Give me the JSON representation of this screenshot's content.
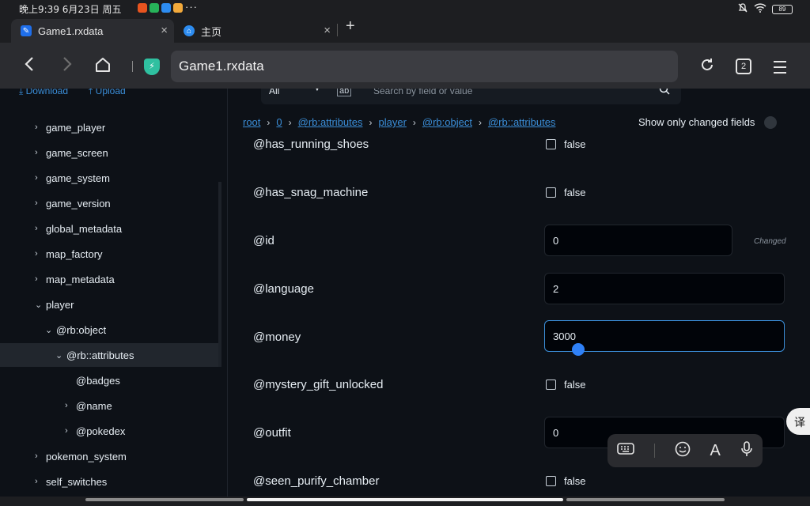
{
  "status": {
    "time": "晚上9:39 6月23日 周五",
    "more": "···",
    "battery": "89"
  },
  "tabs": [
    {
      "title": "Game1.rxdata",
      "close": "×"
    },
    {
      "title": "主页",
      "close": "×"
    }
  ],
  "new_tab": "+",
  "url": "Game1.rxdata",
  "tab_count": "2",
  "toolbar": {
    "download": "Download",
    "upload": "Upload"
  },
  "search": {
    "scope": "All",
    "regex": "ab",
    "placeholder": "Search by field or value"
  },
  "sidebar": {
    "items": [
      {
        "label": "game_player",
        "chev": "›"
      },
      {
        "label": "game_screen",
        "chev": "›"
      },
      {
        "label": "game_system",
        "chev": "›"
      },
      {
        "label": "game_version",
        "chev": "›"
      },
      {
        "label": "global_metadata",
        "chev": "›"
      },
      {
        "label": "map_factory",
        "chev": "›"
      },
      {
        "label": "map_metadata",
        "chev": "›"
      },
      {
        "label": "player",
        "chev": "⌄"
      },
      {
        "label": "@rb:object",
        "chev": "⌄"
      },
      {
        "label": "@rb::attributes",
        "chev": "⌄"
      },
      {
        "label": "@badges",
        "chev": ""
      },
      {
        "label": "@name",
        "chev": "›"
      },
      {
        "label": "@pokedex",
        "chev": "›"
      },
      {
        "label": "pokemon_system",
        "chev": "›"
      },
      {
        "label": "self_switches",
        "chev": "›"
      }
    ]
  },
  "breadcrumb": [
    "root",
    "0",
    "@rb:attributes",
    "player",
    "@rb:object",
    "@rb::attributes"
  ],
  "show_changed_label": "Show only changed fields",
  "fields": [
    {
      "name": "@has_running_shoes",
      "type": "bool",
      "value": "false"
    },
    {
      "name": "@has_snag_machine",
      "type": "bool",
      "value": "false"
    },
    {
      "name": "@id",
      "type": "text",
      "value": "0",
      "tag": "Changed"
    },
    {
      "name": "@language",
      "type": "text",
      "value": "2"
    },
    {
      "name": "@money",
      "type": "text",
      "value": "3000"
    },
    {
      "name": "@mystery_gift_unlocked",
      "type": "bool",
      "value": "false"
    },
    {
      "name": "@outfit",
      "type": "text",
      "value": "0"
    },
    {
      "name": "@seen_purify_chamber",
      "type": "bool",
      "value": "false"
    }
  ],
  "translate": "译",
  "ime_icons": [
    "keyboard-icon",
    "emoji-icon",
    "font-icon",
    "mic-icon"
  ]
}
